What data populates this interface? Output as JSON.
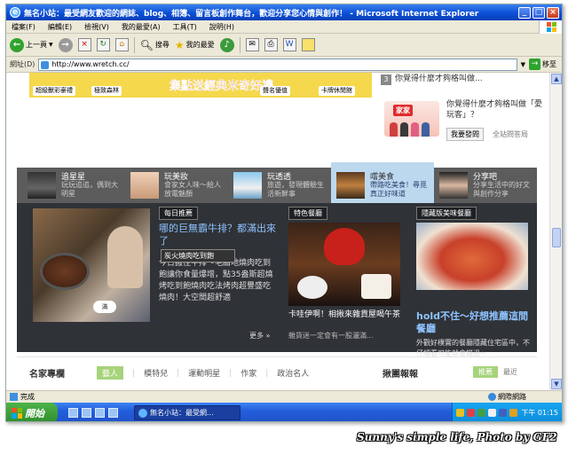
{
  "window": {
    "title": "無名小站：最受網友歡迎的網誌、blog、相簿、留言板創作舞台，歡迎分享您心情與創作！ - Microsoft Internet Explorer",
    "controls": [
      "_",
      "□",
      "×"
    ]
  },
  "menubar": [
    "檔案(F)",
    "編輯(E)",
    "檢視(V)",
    "我的最愛(A)",
    "工具(T)",
    "說明(H)"
  ],
  "toolbar": {
    "back_label": "上一頁",
    "search_label": "搜尋",
    "favorites_label": "我的最愛"
  },
  "address": {
    "label": "網址(D)",
    "url": "http://www.wretch.cc/",
    "go_label": "移至"
  },
  "banner": {
    "tag1": "超級獸彩豪禮",
    "tag2": "極致森林",
    "center_text": "集點送經典米奇好禮",
    "tag3": "聲名優值",
    "tag4": "卡牌休閒館"
  },
  "qa": {
    "number": "3",
    "question": "你覺得什麼才夠格叫做...",
    "ad_logo": "家家",
    "ad_question": "你覺得什麼才夠格叫做「愛玩客」？",
    "ask_button": "我要發問",
    "more": "全站問答局"
  },
  "nav": [
    {
      "title": "追星星",
      "desc": "玩玩追追，偶到大明星"
    },
    {
      "title": "玩美妝",
      "desc": "會家女人味～給人放電魅顏"
    },
    {
      "title": "玩透透",
      "desc": "旅遊，發現體驗生活新鮮事"
    },
    {
      "title": "嚐美食",
      "desc": "帶路吃美食！尋覓真正好味道"
    },
    {
      "title": "分享吧",
      "desc": "分享生活中的好文與創作分享"
    }
  ],
  "panel": {
    "tag_daily": "每日推薦",
    "feat_title": "哪的巨無霸牛排？都滿出來了",
    "feat_overlay": "炭火燒肉吃到飽",
    "feat_desc": "今日搬往牛排～毛甜地燒肉吃到飽讓你食量爆增，點35盎斯超燒烤吃到飽燒肉吃法烤肉超豐盛吃燒肉！大空間超舒適",
    "more": "更多 »",
    "bubble": "滿",
    "tag_special": "特色餐廳",
    "col2_title": "卡哇伊啊！相揪來雜貨屋喝午茶",
    "col2_desc": "雜貨迷一定會有一股灑滿...",
    "tag_hidden": "隱藏版美味餐廳",
    "col3_title": "hold不住～好想推薦這間餐廳",
    "col3_desc": "外觀好樸實的餐廳隱藏住宅區中，不仔細看可能就會錯過～"
  },
  "section": {
    "title": "名家專欄",
    "tabs": [
      "藝人",
      "模特兒",
      "運動明星",
      "作家",
      "政治名人"
    ],
    "right_title": "揪團報報",
    "right_tabs": [
      "推薦",
      "最近"
    ]
  },
  "status": {
    "text": "完成",
    "zone": "網際網路"
  },
  "taskbar": {
    "start": "開始",
    "task": "無名小站：最受網...",
    "clock": "下午 01:15"
  },
  "watermark": "Sunny's simple life, Photo by GF2",
  "colors": {
    "titlebar": "#0b4fd6",
    "panel_bg": "#2f3236",
    "nav_bg": "#5c5c5c",
    "link_blue": "#8ec2ff",
    "tab_green": "#a7d37b"
  }
}
